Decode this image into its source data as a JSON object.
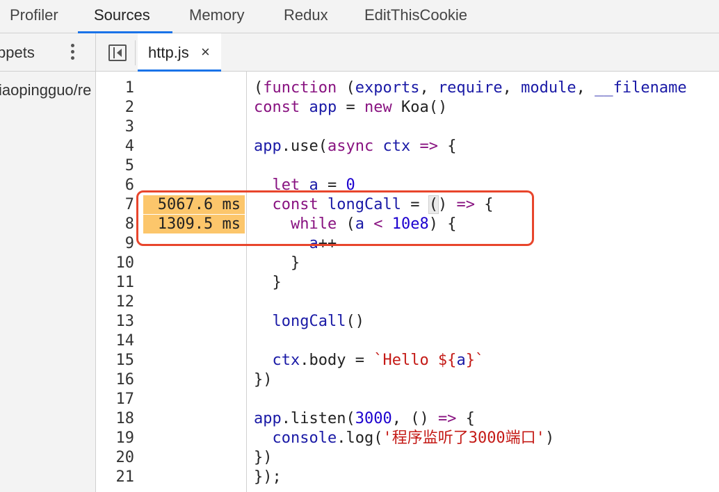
{
  "top_tabs": [
    "Profiler",
    "Sources",
    "Memory",
    "Redux",
    "EditThisCookie"
  ],
  "active_top_tab": "Sources",
  "navigator": {
    "title": "ppets",
    "path": "iaopingguo/re"
  },
  "editor_tab": {
    "file": "http.js",
    "close": "×"
  },
  "code_lines": [
    {
      "n": "1"
    },
    {
      "n": "2"
    },
    {
      "n": "3"
    },
    {
      "n": "4"
    },
    {
      "n": "5"
    },
    {
      "n": "6"
    },
    {
      "n": "7"
    },
    {
      "n": "8"
    },
    {
      "n": "9"
    },
    {
      "n": "10"
    },
    {
      "n": "11"
    },
    {
      "n": "12"
    },
    {
      "n": "13"
    },
    {
      "n": "14"
    },
    {
      "n": "15"
    },
    {
      "n": "16"
    },
    {
      "n": "17"
    },
    {
      "n": "18"
    },
    {
      "n": "19"
    },
    {
      "n": "20"
    },
    {
      "n": "21"
    }
  ],
  "code": [
    "(function (exports, require, module, __filename",
    "const app = new Koa()",
    "",
    "app.use(async ctx => {",
    "",
    "  let a = 0",
    "  const longCall = () => {",
    "    while (a < 10e8) {",
    "      a++",
    "    }",
    "  }",
    "",
    "  longCall()",
    "",
    "  ctx.body = `Hello ${a}`",
    "})",
    "",
    "app.listen(3000, () => {",
    "  console.log('程序监听了3000端口')",
    "})",
    "});"
  ],
  "timings": [
    {
      "line": 7,
      "label": "5067.6 ms"
    },
    {
      "line": 8,
      "label": "1309.5 ms"
    }
  ],
  "colors": {
    "accent": "#1a73e8",
    "perf_bar": "#fcc66b",
    "annotation": "#e8452c"
  }
}
